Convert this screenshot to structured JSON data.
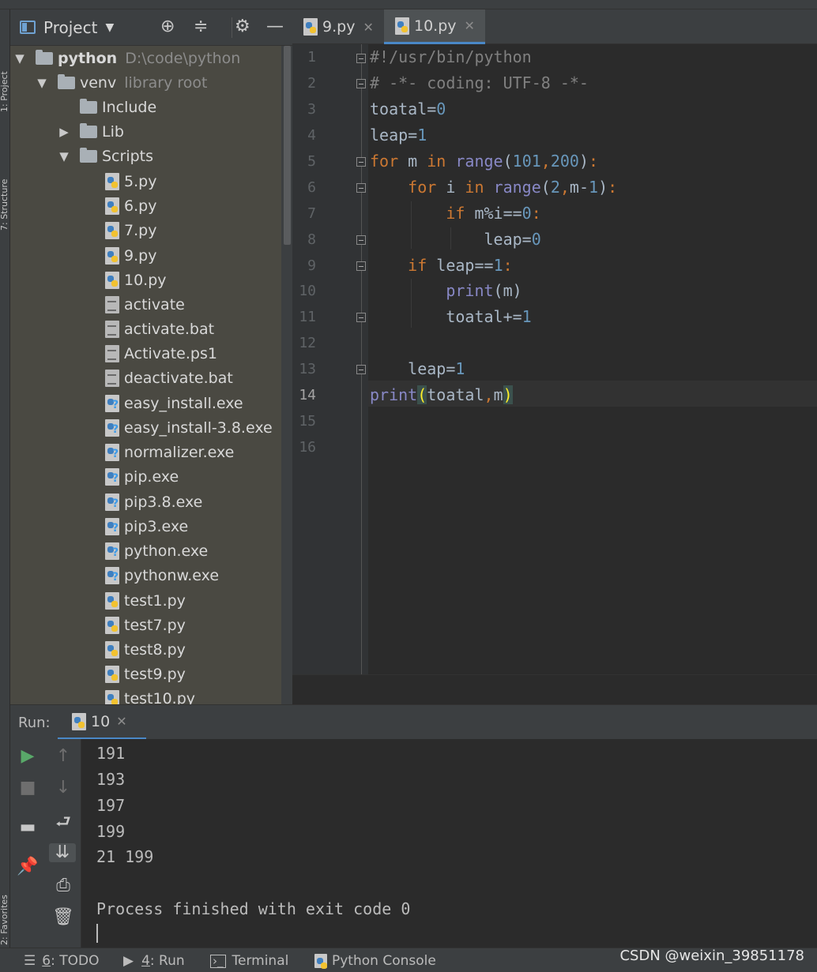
{
  "left_strip": {
    "label_top": "1: Project",
    "label_mid": "7: Structure",
    "label_bottom": "2: Favorites"
  },
  "project_panel": {
    "title": "Project",
    "tree": [
      {
        "label": "python",
        "detail": "D:\\code\\python",
        "type": "folder",
        "expanded": true
      },
      {
        "label": "venv",
        "detail": "library root",
        "type": "folder",
        "expanded": true
      },
      {
        "label": "Include",
        "type": "folder"
      },
      {
        "label": "Lib",
        "type": "folder",
        "expanded": false
      },
      {
        "label": "Scripts",
        "type": "folder",
        "expanded": true
      },
      {
        "label": "5.py",
        "type": "py"
      },
      {
        "label": "6.py",
        "type": "py"
      },
      {
        "label": "7.py",
        "type": "py"
      },
      {
        "label": "9.py",
        "type": "py"
      },
      {
        "label": "10.py",
        "type": "py"
      },
      {
        "label": "activate",
        "type": "txt"
      },
      {
        "label": "activate.bat",
        "type": "txt"
      },
      {
        "label": "Activate.ps1",
        "type": "txt"
      },
      {
        "label": "deactivate.bat",
        "type": "txt"
      },
      {
        "label": "easy_install.exe",
        "type": "exe"
      },
      {
        "label": "easy_install-3.8.exe",
        "type": "exe"
      },
      {
        "label": "normalizer.exe",
        "type": "exe"
      },
      {
        "label": "pip.exe",
        "type": "exe"
      },
      {
        "label": "pip3.8.exe",
        "type": "exe"
      },
      {
        "label": "pip3.exe",
        "type": "exe"
      },
      {
        "label": "python.exe",
        "type": "exe"
      },
      {
        "label": "pythonw.exe",
        "type": "exe"
      },
      {
        "label": "test1.py",
        "type": "py"
      },
      {
        "label": "test7.py",
        "type": "py"
      },
      {
        "label": "test8.py",
        "type": "py"
      },
      {
        "label": "test9.py",
        "type": "py"
      },
      {
        "label": "test10.py",
        "type": "py"
      }
    ]
  },
  "editor": {
    "tabs": [
      {
        "label": "9.py",
        "active": false
      },
      {
        "label": "10.py",
        "active": true
      }
    ],
    "current_line": 14,
    "lines": [
      {
        "n": "1",
        "text": "#!/usr/bin/python"
      },
      {
        "n": "2",
        "text": "# -*- coding: UTF-8 -*-"
      },
      {
        "n": "3",
        "text": "toatal=0"
      },
      {
        "n": "4",
        "text": "leap=1"
      },
      {
        "n": "5",
        "text": "for m in range(101,200):"
      },
      {
        "n": "6",
        "text": "    for i in range(2,m-1):"
      },
      {
        "n": "7",
        "text": "        if m%i==0:"
      },
      {
        "n": "8",
        "text": "            leap=0"
      },
      {
        "n": "9",
        "text": "    if leap==1:"
      },
      {
        "n": "10",
        "text": "        print(m)"
      },
      {
        "n": "11",
        "text": "        toatal+=1"
      },
      {
        "n": "12",
        "text": ""
      },
      {
        "n": "13",
        "text": "    leap=1"
      },
      {
        "n": "14",
        "text": "print(toatal,m)"
      },
      {
        "n": "15",
        "text": ""
      },
      {
        "n": "16",
        "text": ""
      }
    ]
  },
  "run_panel": {
    "label": "Run:",
    "tab_label": "10",
    "output": [
      "191",
      "193",
      "197",
      "199",
      "21 199",
      "",
      "Process finished with exit code 0"
    ]
  },
  "status_bar": {
    "todo_num": "6",
    "todo_label": ": TODO",
    "run_num": "4",
    "run_label": ": Run",
    "terminal_label": "Terminal",
    "console_label": "Python Console",
    "watermark": "CSDN @weixin_39851178"
  },
  "colors": {
    "background": "#2b2b2b",
    "panel": "#3c3f41",
    "tree_bg": "#4a4942",
    "keyword": "#cc7832",
    "number": "#6897bb",
    "comment": "#808080",
    "builtin": "#8888c6",
    "accent": "#4a88c7"
  }
}
